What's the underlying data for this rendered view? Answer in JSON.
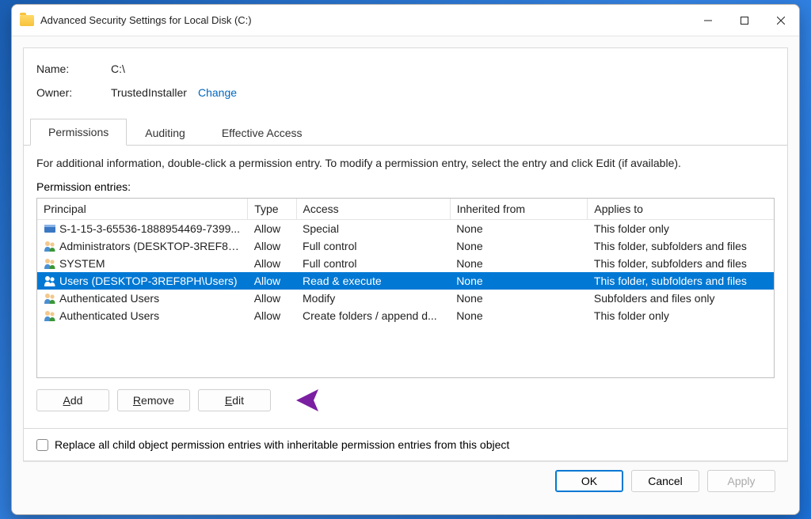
{
  "window": {
    "title": "Advanced Security Settings for Local Disk (C:)"
  },
  "header": {
    "name_label": "Name:",
    "name_value": "C:\\",
    "owner_label": "Owner:",
    "owner_value": "TrustedInstaller",
    "change_link": "Change"
  },
  "tabs": {
    "permissions": "Permissions",
    "auditing": "Auditing",
    "effective": "Effective Access"
  },
  "body": {
    "info": "For additional information, double-click a permission entry. To modify a permission entry, select the entry and click Edit (if available).",
    "entries_label": "Permission entries:",
    "columns": {
      "principal": "Principal",
      "type": "Type",
      "access": "Access",
      "inherited": "Inherited from",
      "applies": "Applies to"
    },
    "rows": [
      {
        "icon": "app",
        "principal": "S-1-15-3-65536-1888954469-7399...",
        "type": "Allow",
        "access": "Special",
        "inherited": "None",
        "applies": "This folder only"
      },
      {
        "icon": "group",
        "principal": "Administrators (DESKTOP-3REF8P...",
        "type": "Allow",
        "access": "Full control",
        "inherited": "None",
        "applies": "This folder, subfolders and files"
      },
      {
        "icon": "group",
        "principal": "SYSTEM",
        "type": "Allow",
        "access": "Full control",
        "inherited": "None",
        "applies": "This folder, subfolders and files"
      },
      {
        "icon": "group",
        "principal": "Users (DESKTOP-3REF8PH\\Users)",
        "type": "Allow",
        "access": "Read & execute",
        "inherited": "None",
        "applies": "This folder, subfolders and files",
        "selected": true
      },
      {
        "icon": "group",
        "principal": "Authenticated Users",
        "type": "Allow",
        "access": "Modify",
        "inherited": "None",
        "applies": "Subfolders and files only"
      },
      {
        "icon": "group",
        "principal": "Authenticated Users",
        "type": "Allow",
        "access": "Create folders / append d...",
        "inherited": "None",
        "applies": "This folder only"
      }
    ]
  },
  "buttons": {
    "add": "Add",
    "remove": "Remove",
    "edit": "Edit"
  },
  "checkbox": {
    "label": "Replace all child object permission entries with inheritable permission entries from this object"
  },
  "footer": {
    "ok": "OK",
    "cancel": "Cancel",
    "apply": "Apply"
  }
}
